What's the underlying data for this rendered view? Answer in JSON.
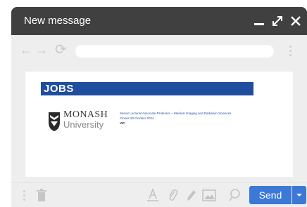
{
  "window": {
    "title": "New message"
  },
  "browser": {
    "url": ""
  },
  "ad": {
    "heading": "JOBS",
    "logo_line1": "MONASH",
    "logo_line2": "University",
    "job_title": "Senior Lecturer/Associate Professor – Medical Imaging and Radiation Sciences",
    "closes": "Closes 20 October 2024",
    "location": "VIC"
  },
  "compose": {
    "send_label": "Send"
  },
  "colors": {
    "titlebar": "#404040",
    "banner": "#1f4e9e",
    "send_button": "#3c78d8"
  },
  "icons": [
    "minimize-icon",
    "expand-icon",
    "close-icon",
    "back-arrow-icon",
    "forward-arrow-icon",
    "reload-icon",
    "more-vertical-icon",
    "trash-icon",
    "text-format-icon",
    "attachment-icon",
    "pen-icon",
    "image-icon",
    "location-pin-icon",
    "chevron-down-icon"
  ]
}
